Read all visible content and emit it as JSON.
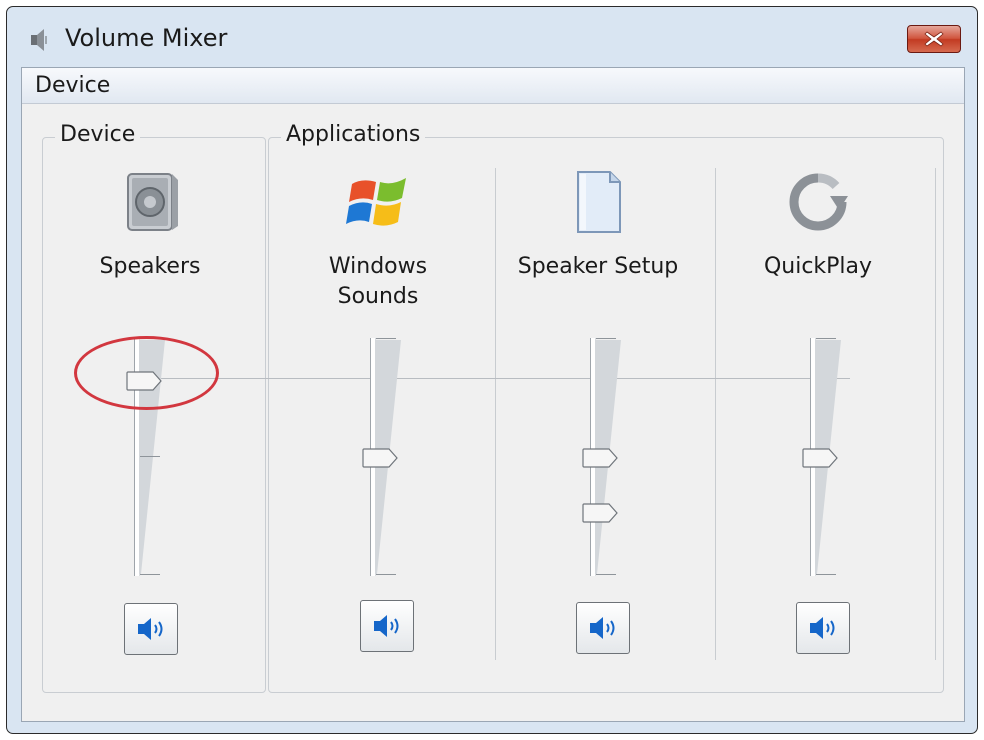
{
  "window": {
    "title": "Volume Mixer",
    "title_icon": "speaker-small-icon",
    "close_icon": "close-x-icon",
    "colors": {
      "close_button": "#c94a32",
      "highlight_circle": "#d2373f",
      "speaker_icon_blue": "#1566c9"
    }
  },
  "menu": {
    "items": [
      {
        "label": "Device"
      }
    ]
  },
  "device_group": {
    "label": "Device",
    "channel": {
      "label": "Speakers",
      "icon": "speakers-icon",
      "volume_percent": 85,
      "mute_icon": "speaker-volume-icon"
    }
  },
  "applications_group": {
    "label": "Applications",
    "channels": [
      {
        "label_lines": [
          "Windows",
          "Sounds"
        ],
        "icon": "windows-logo-icon",
        "volume_percent": 50,
        "mute_icon": "speaker-volume-icon"
      },
      {
        "label": "Speaker Setup",
        "icon": "document-icon",
        "volume_percent": 50,
        "secondary_volume_percent": 25,
        "mute_icon": "speaker-volume-icon"
      },
      {
        "label": "QuickPlay",
        "icon": "quickplay-icon",
        "volume_percent": 50,
        "mute_icon": "speaker-volume-icon"
      }
    ]
  }
}
